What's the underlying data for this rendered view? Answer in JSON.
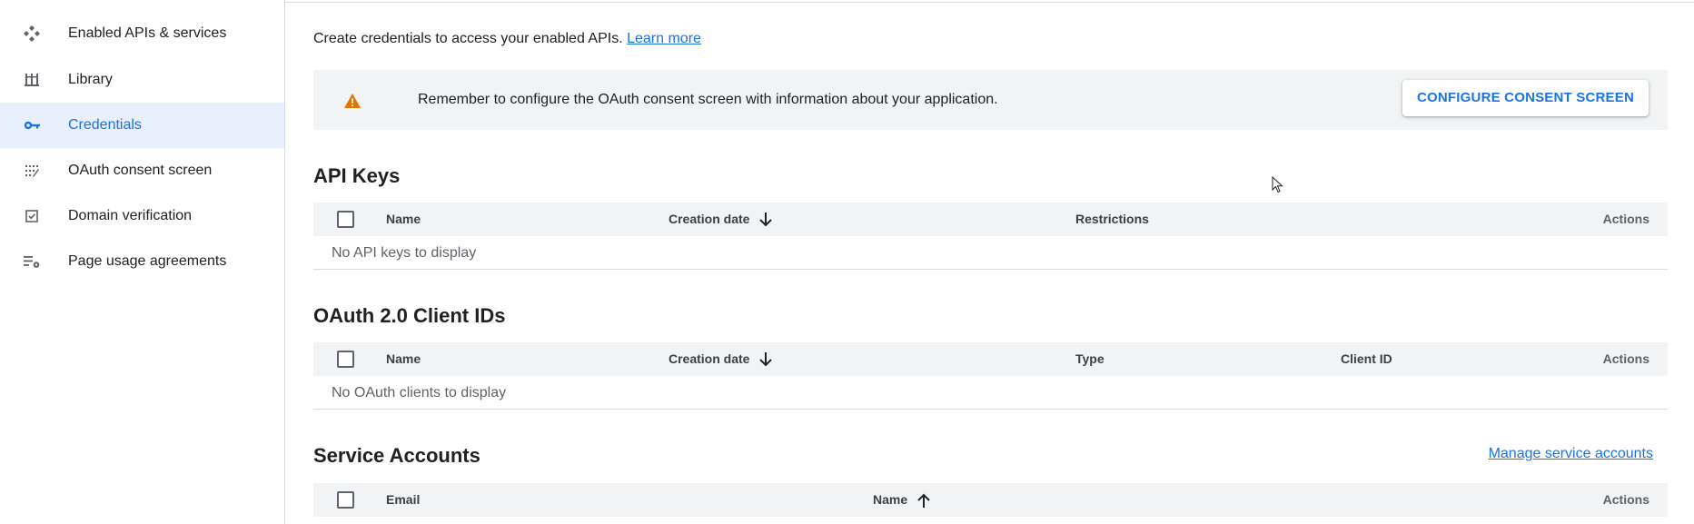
{
  "sidebar": {
    "items": [
      {
        "label": "Enabled APIs & services",
        "icon": "api-diamond-icon",
        "active": false
      },
      {
        "label": "Library",
        "icon": "library-icon",
        "active": false
      },
      {
        "label": "Credentials",
        "icon": "key-icon",
        "active": true
      },
      {
        "label": "OAuth consent screen",
        "icon": "consent-grid-icon",
        "active": false
      },
      {
        "label": "Domain verification",
        "icon": "checkbox-icon",
        "active": false
      },
      {
        "label": "Page usage agreements",
        "icon": "settings-list-icon",
        "active": false
      }
    ]
  },
  "intro": {
    "text": "Create credentials to access your enabled APIs.",
    "link": "Learn more"
  },
  "banner": {
    "message": "Remember to configure the OAuth consent screen with information about your application.",
    "button": "CONFIGURE CONSENT SCREEN",
    "icon": "warning-icon",
    "icon_color": "#e37400"
  },
  "api_keys": {
    "title": "API Keys",
    "columns": [
      "Name",
      "Creation date",
      "Restrictions",
      "Actions"
    ],
    "empty": "No API keys to display"
  },
  "oauth_clients": {
    "title": "OAuth 2.0 Client IDs",
    "columns": [
      "Name",
      "Creation date",
      "Type",
      "Client ID",
      "Actions"
    ],
    "empty": "No OAuth clients to display"
  },
  "service_accounts": {
    "title": "Service Accounts",
    "manage_link": "Manage service accounts",
    "columns": [
      "Email",
      "Name",
      "Actions"
    ]
  },
  "colors": {
    "accent": "#1a73e8",
    "active_bg": "#e8f0fe",
    "table_header_bg": "#f1f3f4"
  }
}
